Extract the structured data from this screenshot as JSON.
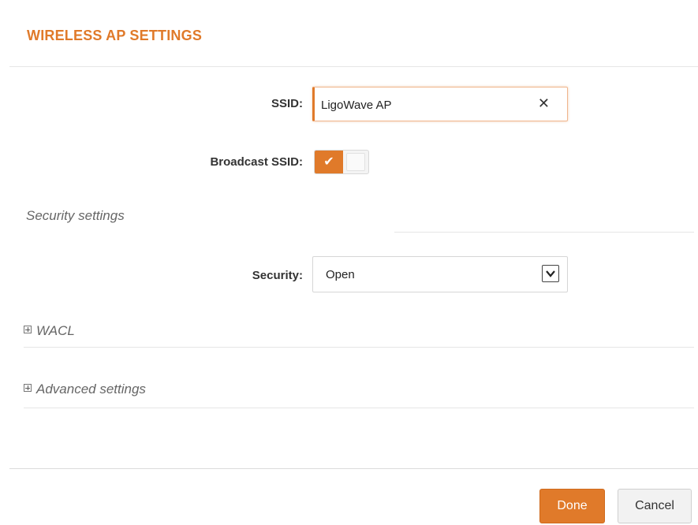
{
  "dialog": {
    "title": "WIRELESS AP SETTINGS"
  },
  "ssid": {
    "label": "SSID:",
    "value": "LigoWave AP",
    "clear_icon": "close-icon"
  },
  "broadcast_ssid": {
    "label": "Broadcast SSID:",
    "enabled": true,
    "check_glyph": "✔"
  },
  "security_settings": {
    "heading": "Security settings",
    "security_label": "Security:",
    "security_value": "Open"
  },
  "sections": {
    "wacl": "WACL",
    "advanced": "Advanced settings"
  },
  "footer": {
    "done_label": "Done",
    "cancel_label": "Cancel"
  },
  "colors": {
    "accent": "#e07a2a",
    "text": "#333333",
    "muted": "#666666"
  }
}
